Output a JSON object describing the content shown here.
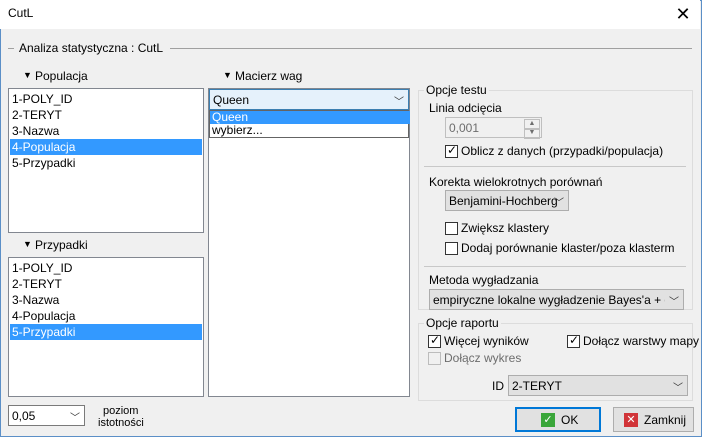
{
  "window": {
    "title": "CutL",
    "close_glyph": "✕"
  },
  "group_title": "Analiza statystyczna : CutL",
  "populacja": {
    "label": "Populacja",
    "items": [
      "1-POLY_ID",
      "2-TERYT",
      "3-Nazwa",
      "4-Populacja",
      "5-Przypadki"
    ],
    "selected_index": 3
  },
  "przypadki": {
    "label": "Przypadki",
    "items": [
      "1-POLY_ID",
      "2-TERYT",
      "3-Nazwa",
      "4-Populacja",
      "5-Przypadki"
    ],
    "selected_index": 4
  },
  "macierz": {
    "label": "Macierz wag",
    "selected": "Queen",
    "dropdown_items": [
      "Queen",
      "wybierz..."
    ]
  },
  "opcje_testu": {
    "title": "Opcje testu",
    "linia_label": "Linia odcięcia",
    "linia_value": "0,001",
    "oblicz_label": "Oblicz z danych (przypadki/populacja)",
    "oblicz_checked": true,
    "korekta_label": "Korekta wielokrotnych porównań",
    "korekta_value": "Benjamini-Hochberg",
    "zwieksz_label": "Zwiększ klastery",
    "zwieksz_checked": false,
    "dodaj_label": "Dodaj porównanie klaster/poza klasterm",
    "dodaj_checked": false,
    "metoda_label": "Metoda wygładzania",
    "metoda_value": "empiryczne lokalne wygładzenie Bayes'a + dosto"
  },
  "opcje_raportu": {
    "title": "Opcje raportu",
    "wiecej_label": "Więcej wyników",
    "wiecej_checked": true,
    "dolacz_warstwy_label": "Dołącz warstwy mapy",
    "dolacz_warstwy_checked": true,
    "dolacz_wykres_label": "Dołącz wykres",
    "dolacz_wykres_checked": false,
    "id_label": "ID",
    "id_value": "2-TERYT"
  },
  "poziom": {
    "value": "0,05",
    "label_line1": "poziom",
    "label_line2": "istotności"
  },
  "buttons": {
    "ok": "OK",
    "zamknij": "Zamknij"
  },
  "colors": {
    "selection": "#3399ff",
    "accent": "#0078d7",
    "ok_icon": "#3aa63a",
    "close_icon": "#d13438"
  }
}
